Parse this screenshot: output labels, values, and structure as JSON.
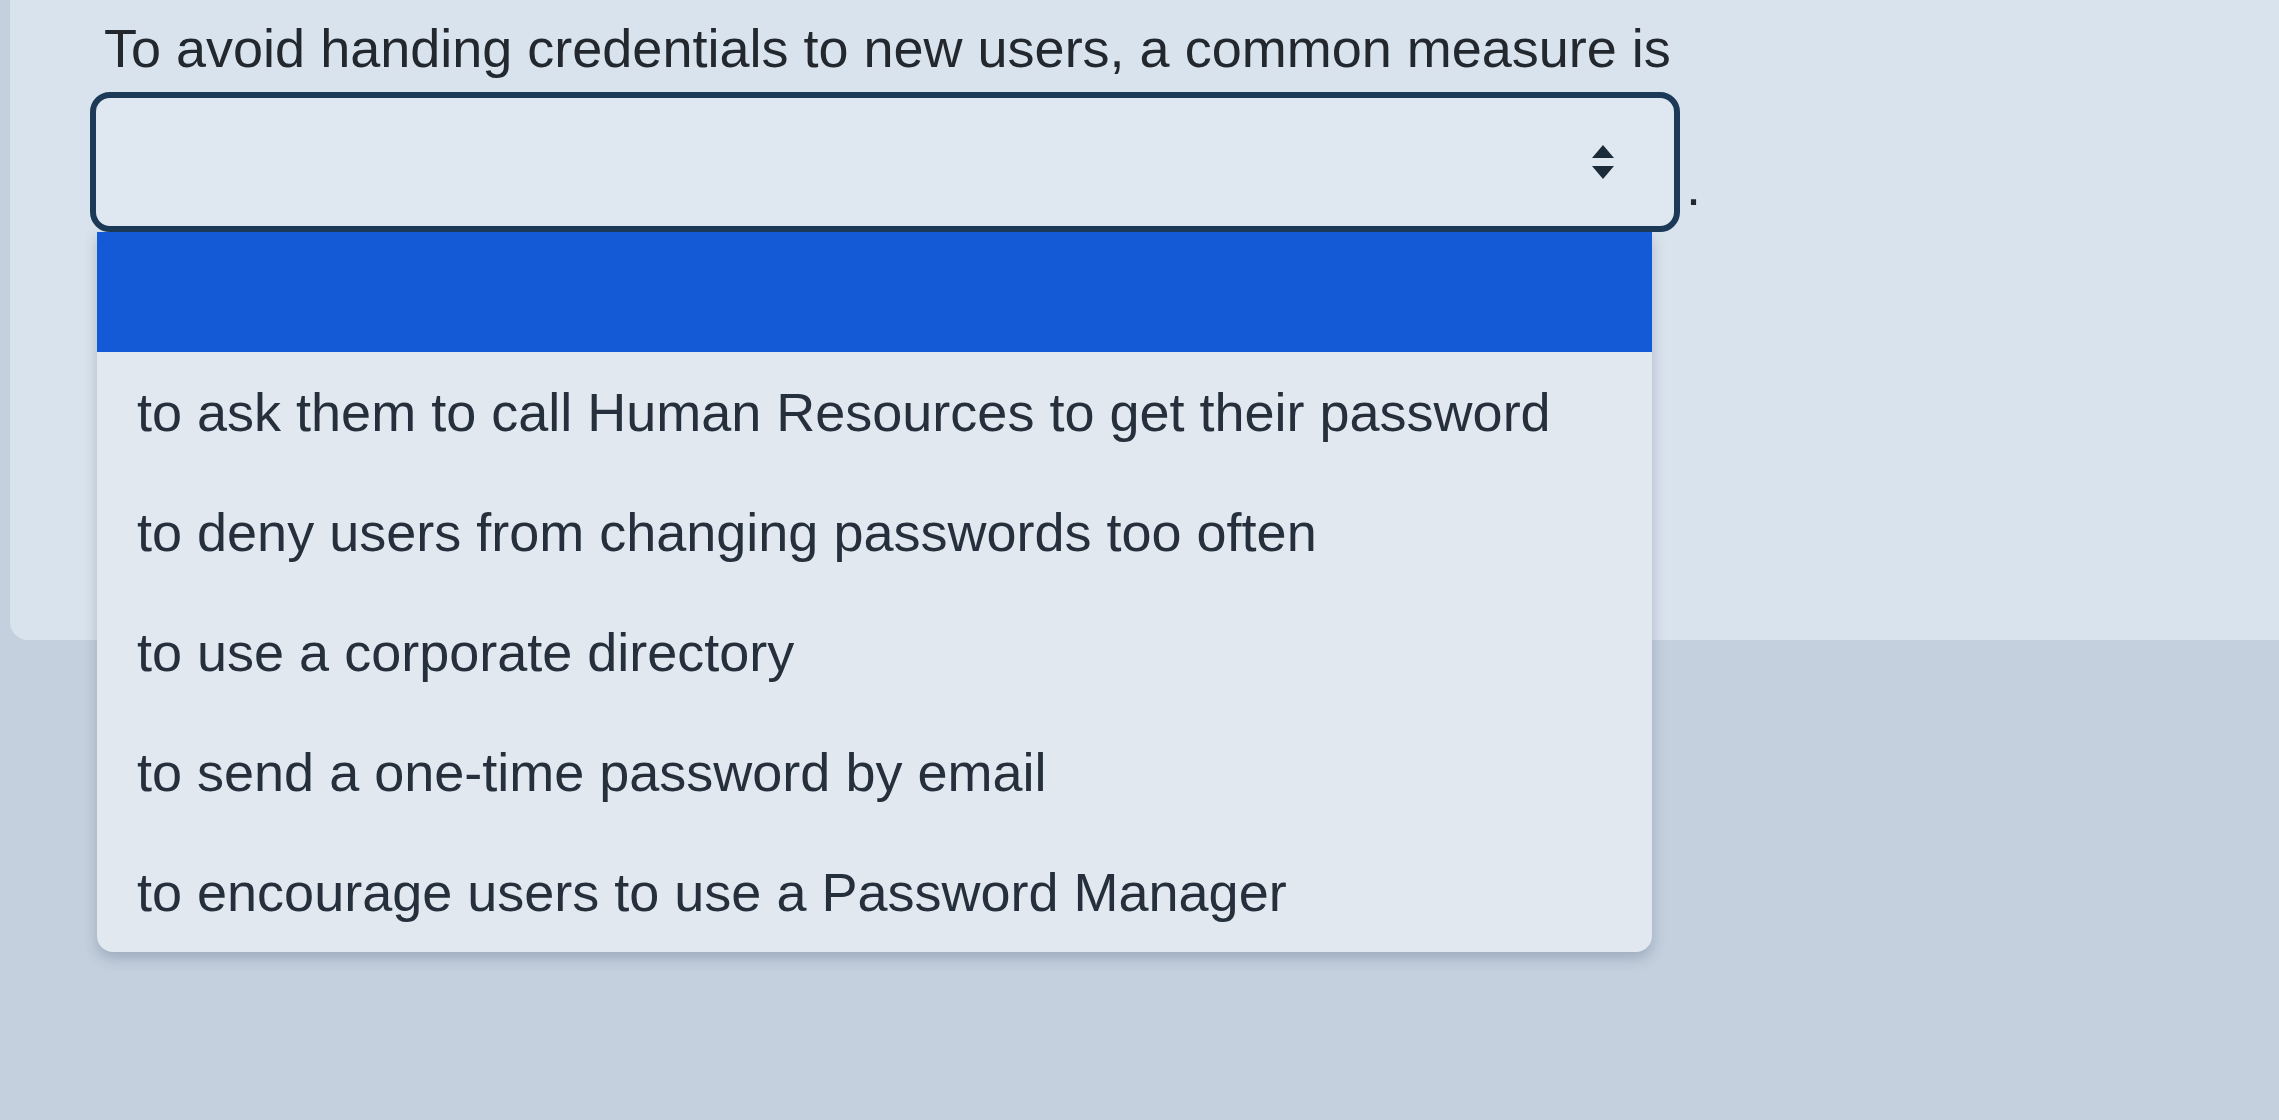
{
  "question": {
    "text": "To avoid handing credentials to new users, a common measure is",
    "after": "."
  },
  "select": {
    "expanded": true
  },
  "options": [
    {
      "selected": true
    },
    {
      "label": "to ask them to call Human Resources to get their password",
      "selected": false
    },
    {
      "label": "to deny users from changing passwords too often",
      "selected": false
    },
    {
      "label": "to use a corporate directory",
      "selected": false
    },
    {
      "label": "to send a one-time password by email",
      "selected": false
    },
    {
      "label": "to encourage users to use a Password Manager",
      "selected": false
    }
  ]
}
